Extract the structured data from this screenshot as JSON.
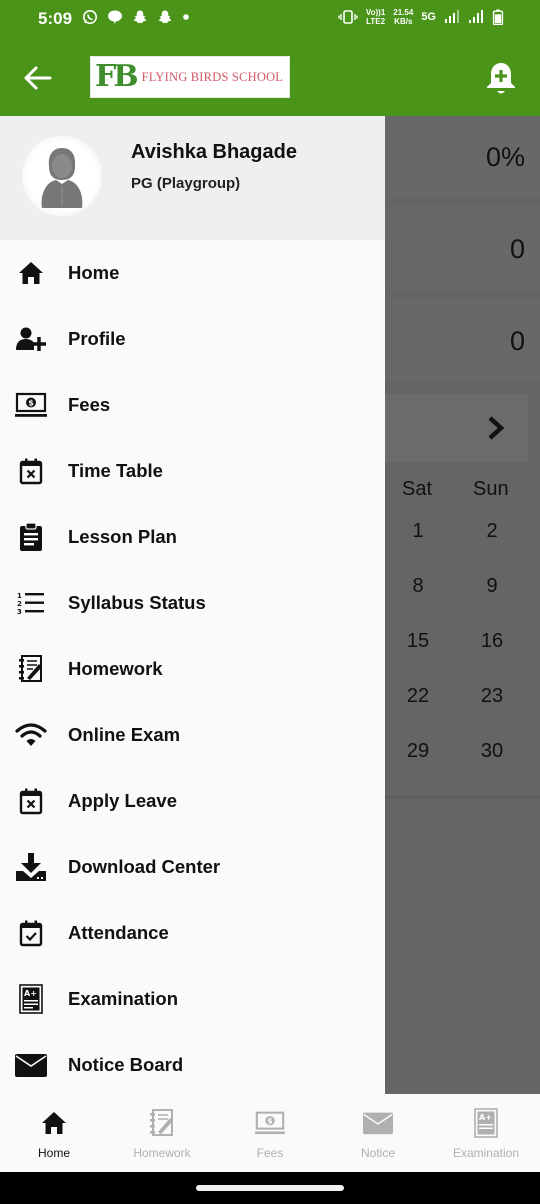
{
  "status_bar": {
    "time": "5:09",
    "notification_icons": [
      "whatsapp-icon",
      "chat-bubble-icon",
      "snapchat-icon",
      "snapchat-icon",
      "dot-icon"
    ],
    "network_top": "Vo))1",
    "network_bottom": "LTE2",
    "speed_top": "21.54",
    "speed_bottom": "KB/s",
    "network_type": "5G"
  },
  "app_bar": {
    "logo_initials": "FB",
    "school_name": "FLYING BIRDS SCHOOL"
  },
  "colors": {
    "brand_green": "#4a941a",
    "scrim": "#656565",
    "drawer_bg": "#fafafa",
    "header_bg": "#efefef",
    "inactive_nav": "#b0b0b0"
  },
  "drawer": {
    "user": {
      "name": "Avishka Bhagade",
      "class": "PG (Playgroup)"
    },
    "menu": [
      {
        "label": "Home",
        "icon": "home-icon"
      },
      {
        "label": "Profile",
        "icon": "add-user-icon"
      },
      {
        "label": "Fees",
        "icon": "fees-laptop-icon"
      },
      {
        "label": "Time Table",
        "icon": "calendar-x-icon"
      },
      {
        "label": "Lesson Plan",
        "icon": "clipboard-icon"
      },
      {
        "label": "Syllabus Status",
        "icon": "numbered-list-icon"
      },
      {
        "label": "Homework",
        "icon": "homework-notebook-icon"
      },
      {
        "label": "Online Exam",
        "icon": "wifi-icon"
      },
      {
        "label": "Apply Leave",
        "icon": "calendar-x-icon"
      },
      {
        "label": "Download Center",
        "icon": "download-icon"
      },
      {
        "label": "Attendance",
        "icon": "calendar-check-icon"
      },
      {
        "label": "Examination",
        "icon": "exam-grade-icon"
      },
      {
        "label": "Notice Board",
        "icon": "envelope-icon"
      }
    ]
  },
  "background": {
    "stats": [
      "0%",
      "0",
      "0"
    ],
    "calendar": {
      "headers": [
        "Sat",
        "Sun"
      ],
      "rows": [
        [
          "1",
          "2"
        ],
        [
          "8",
          "9"
        ],
        [
          "15",
          "16"
        ],
        [
          "22",
          "23"
        ],
        [
          "29",
          "30"
        ]
      ]
    }
  },
  "bottom_nav": {
    "items": [
      {
        "label": "Home",
        "icon": "home-icon",
        "active": true
      },
      {
        "label": "Homework",
        "icon": "homework-notebook-icon",
        "active": false
      },
      {
        "label": "Fees",
        "icon": "fees-laptop-icon",
        "active": false
      },
      {
        "label": "Notice",
        "icon": "envelope-icon",
        "active": false
      },
      {
        "label": "Examination",
        "icon": "exam-grade-icon",
        "active": false
      }
    ]
  }
}
